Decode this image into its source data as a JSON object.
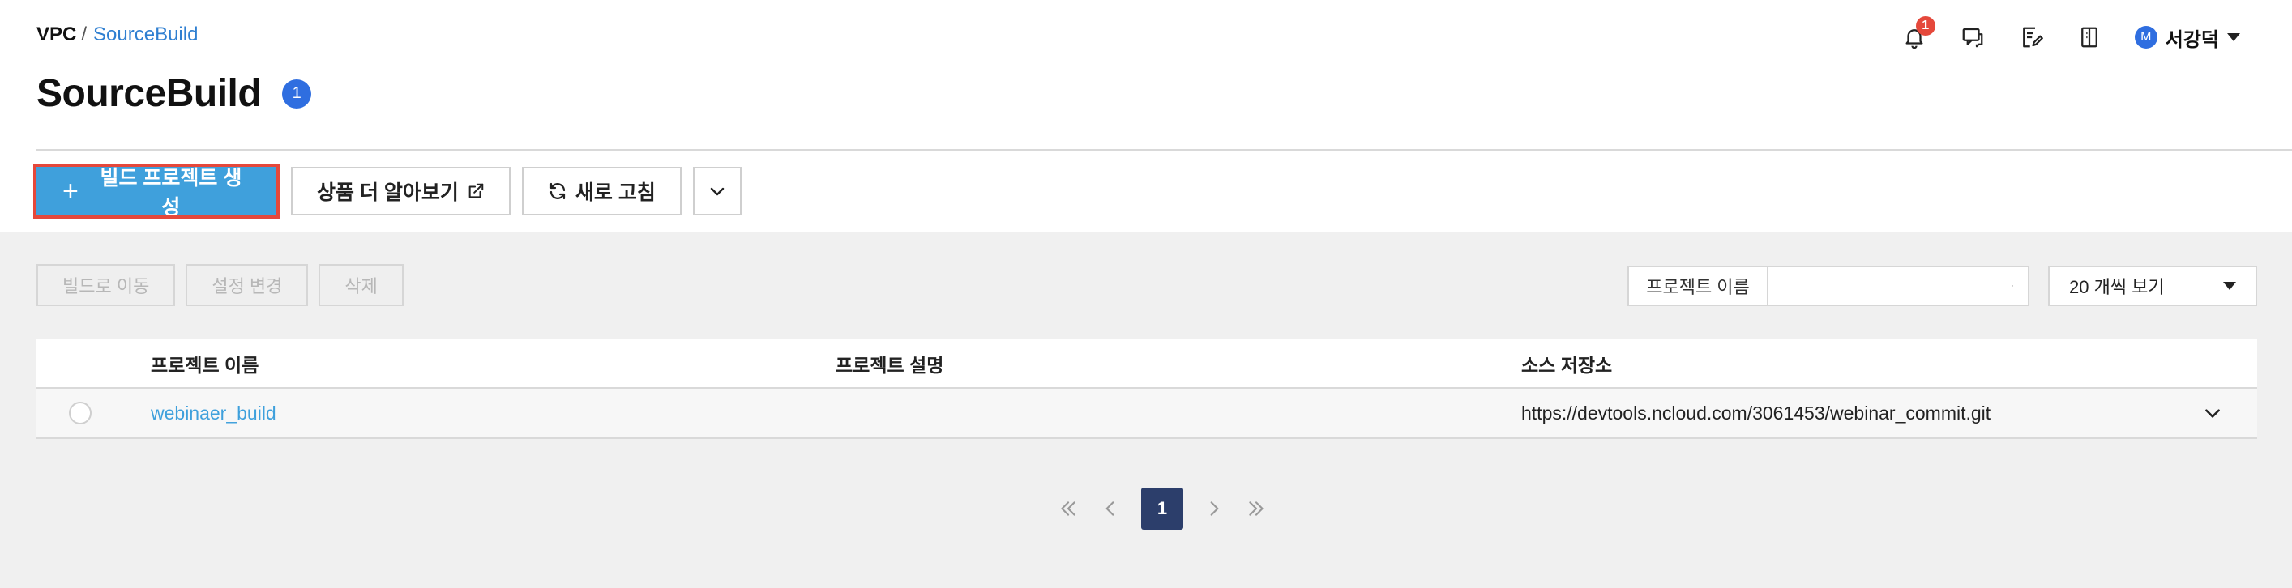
{
  "breadcrumb": {
    "root": "VPC",
    "separator": "/",
    "current": "SourceBuild"
  },
  "header": {
    "notification_count": "1",
    "user_initial": "M",
    "user_name": "서강덕",
    "icons": [
      "bell-icon",
      "chat-icon",
      "memo-edit-icon",
      "manual-book-icon"
    ]
  },
  "page": {
    "title": "SourceBuild",
    "count": "1"
  },
  "toolbar": {
    "create_label": "빌드 프로젝트 생성",
    "learn_more_label": "상품 더 알아보기",
    "refresh_label": "새로 고침"
  },
  "actions": {
    "move_to_build": "빌드로 이동",
    "change_settings": "설정 변경",
    "delete": "삭제"
  },
  "search": {
    "label": "프로젝트 이름",
    "value": "",
    "placeholder": ""
  },
  "per_page": {
    "selected": "20 개씩 보기"
  },
  "table": {
    "columns": [
      "프로젝트 이름",
      "프로젝트 설명",
      "소스 저장소"
    ],
    "rows": [
      {
        "name": "webinaer_build",
        "description": "",
        "repository": "https://devtools.ncloud.com/3061453/webinar_commit.git"
      }
    ]
  },
  "pagination": {
    "current": "1"
  },
  "colors": {
    "primary": "#3fa0dc",
    "link": "#2f7fd1",
    "badge_blue": "#2f6ee0",
    "alert_red": "#e5483b",
    "page_active": "#2c3e6b"
  }
}
